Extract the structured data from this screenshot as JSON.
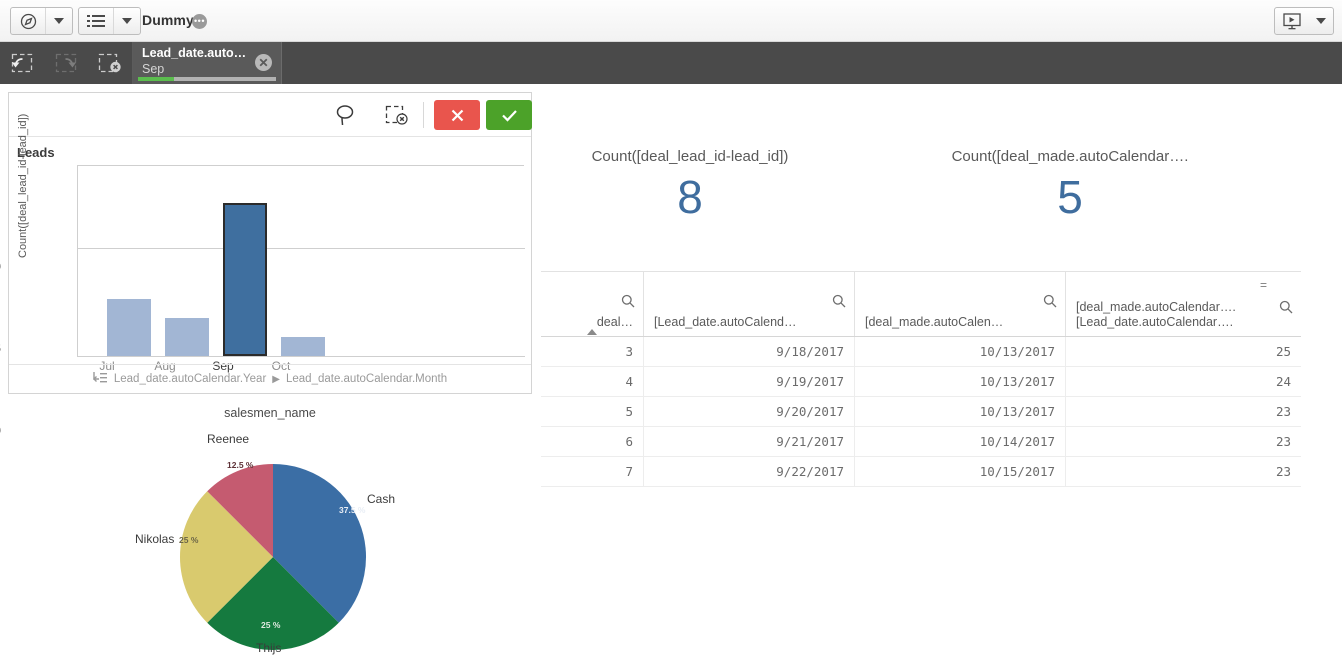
{
  "topbar": {
    "nav_icon": "compass-icon",
    "nav_caret": "chevron-down-icon",
    "sheet_icon": "sheet-list-icon",
    "sheet_caret": "chevron-down-icon",
    "app_title": "Dummy",
    "title_dots": "•••",
    "present_icon": "present-monitor-icon",
    "present_caret": "chevron-down-icon"
  },
  "selection_bar": {
    "step_back_icon": "step-back-icon",
    "step_forward_icon": "step-forward-icon",
    "clear_all_icon": "clear-all-selections-icon",
    "chip": {
      "field": "Lead_date.auto…",
      "value": "Sep",
      "close_icon": "close-icon",
      "fill_percent": 26
    }
  },
  "chart_card": {
    "toolbar": {
      "lasso_icon": "lasso-select-icon",
      "clear_selection_icon": "clear-selection-icon",
      "cancel_label": "✕",
      "confirm_label": "✓"
    },
    "drill": {
      "icon": "drill-down-icon",
      "level1": "Lead_date.autoCalendar.Year",
      "separator": "▶",
      "level2": "Lead_date.autoCalendar.Month"
    }
  },
  "kpis": [
    {
      "title": "Count([deal_lead_id-lead_id])",
      "value": "8"
    },
    {
      "title": "Count([deal_made.autoCalendar….",
      "value": "5"
    }
  ],
  "table": {
    "columns": [
      {
        "line1": "deal…",
        "line2": "",
        "search_icon": "search-icon",
        "sorted": true,
        "eq": ""
      },
      {
        "line1": "[Lead_date.autoCalend…",
        "line2": "",
        "search_icon": "search-icon",
        "sorted": false,
        "eq": ""
      },
      {
        "line1": "[deal_made.autoCalen…",
        "line2": "",
        "search_icon": "search-icon",
        "sorted": false,
        "eq": ""
      },
      {
        "line1": "[deal_made.autoCalendar….",
        "line2": "[Lead_date.autoCalendar….",
        "search_icon": "search-icon",
        "sorted": false,
        "eq": "="
      }
    ],
    "rows": [
      [
        "3",
        "9/18/2017",
        "10/13/2017",
        "25"
      ],
      [
        "4",
        "9/19/2017",
        "10/13/2017",
        "24"
      ],
      [
        "5",
        "9/20/2017",
        "10/13/2017",
        "23"
      ],
      [
        "6",
        "9/21/2017",
        "10/14/2017",
        "23"
      ],
      [
        "7",
        "9/22/2017",
        "10/15/2017",
        "23"
      ]
    ]
  },
  "chart_data": [
    {
      "type": "bar",
      "title": "Leads",
      "categories": [
        "Jul",
        "Aug",
        "Sep",
        "Oct"
      ],
      "values": [
        3,
        2,
        8,
        1
      ],
      "selected": [
        "Sep"
      ],
      "xlabel": "Lead_date.autoCalendar.Month",
      "ylabel": "Count([deal_lead_id-lead_id])",
      "ylim": [
        0,
        10
      ],
      "yticks": [
        "0",
        "5",
        "10"
      ],
      "grid": true,
      "legend": "none",
      "colors": {
        "bar": "#a2b6d4",
        "bar_selected": "#3f6f9f",
        "selected_border": "#2b2b2b"
      }
    },
    {
      "type": "pie",
      "title": "salesmen_name",
      "categories": [
        "Cash",
        "Thijs",
        "Nikolas",
        "Reenee"
      ],
      "values": [
        37.5,
        25,
        25,
        12.5
      ],
      "labels": [
        "37.5 %",
        "25 %",
        "25 %",
        "12.5 %"
      ],
      "colors": [
        "#3b6ea5",
        "#157a3f",
        "#d9ca6e",
        "#c55b70"
      ],
      "legend": "outside-labels",
      "ylabel": "",
      "xlabel": ""
    }
  ],
  "theme": {
    "accent_blue": "#3f6d9e",
    "selection_bar": "#4a4a4a",
    "confirm_green": "#4ca229",
    "cancel_red": "#e9554d",
    "chip_green": "#5bbd4e"
  }
}
